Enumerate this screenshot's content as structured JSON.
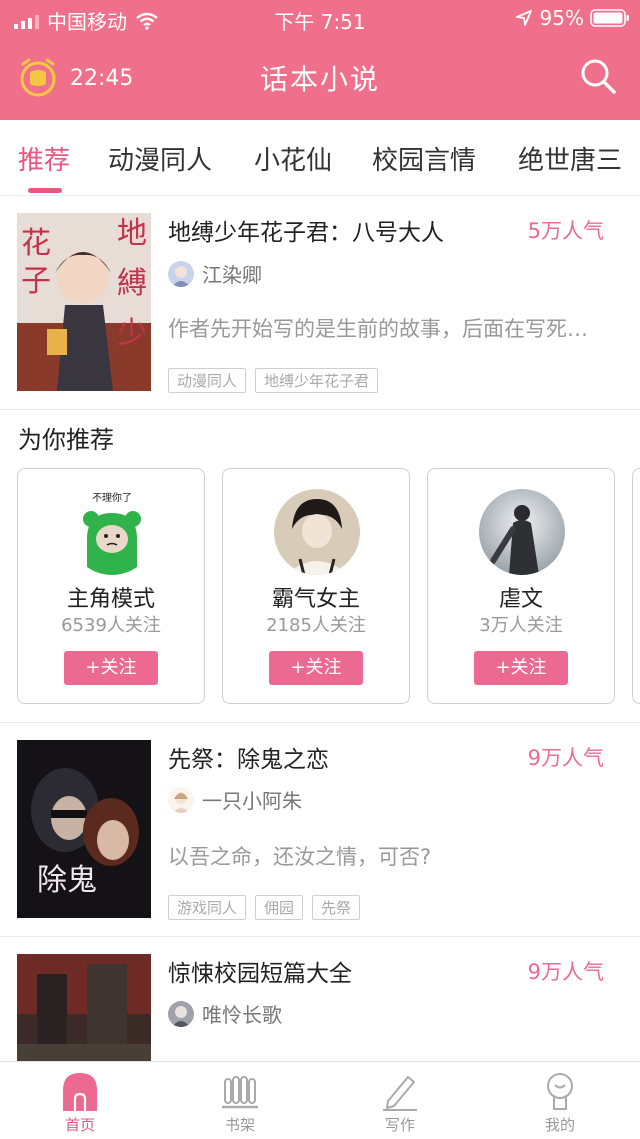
{
  "status_bar": {
    "carrier": "中国移动",
    "time": "下午 7:51",
    "battery": "95%"
  },
  "header": {
    "timer": "22:45",
    "title": "话本小说"
  },
  "tabs": [
    {
      "label": "推荐",
      "active": true
    },
    {
      "label": "动漫同人",
      "active": false
    },
    {
      "label": "小花仙",
      "active": false
    },
    {
      "label": "校园言情",
      "active": false
    },
    {
      "label": "绝世唐三",
      "active": false
    }
  ],
  "books": [
    {
      "title": "地缚少年花子君：八号大人",
      "popularity": "5万人气",
      "author": "江染卿",
      "description": "作者先开始写的是生前的故事，后面在写死后的故事",
      "tags": [
        "动漫同人",
        "地缚少年花子君"
      ]
    },
    {
      "title": "先祭：除鬼之恋",
      "popularity": "9万人气",
      "author": "一只小阿朱",
      "description": "以吾之命，还汝之情，可否?",
      "tags": [
        "游戏同人",
        "佣园",
        "先祭"
      ]
    },
    {
      "title": "惊悚校园短篇大全",
      "popularity": "9万人气",
      "author": "唯怜长歌",
      "description": "",
      "tags": []
    }
  ],
  "recommend": {
    "title": "为你推荐",
    "cards": [
      {
        "name": "主角模式",
        "followers": "6539人关注",
        "button": "+关注",
        "avatar_caption": "不理你了"
      },
      {
        "name": "霸气女主",
        "followers": "2185人关注",
        "button": "+关注"
      },
      {
        "name": "虐文",
        "followers": "3万人关注",
        "button": "+关注"
      }
    ]
  },
  "tabbar": [
    {
      "label": "首页",
      "icon": "home-icon",
      "active": true
    },
    {
      "label": "书架",
      "icon": "bookshelf-icon",
      "active": false
    },
    {
      "label": "写作",
      "icon": "pen-icon",
      "active": false
    },
    {
      "label": "我的",
      "icon": "profile-icon",
      "active": false
    }
  ],
  "colors": {
    "brand": "#f0708c",
    "accent": "#e9577f",
    "popularity": "#ec6a92"
  }
}
